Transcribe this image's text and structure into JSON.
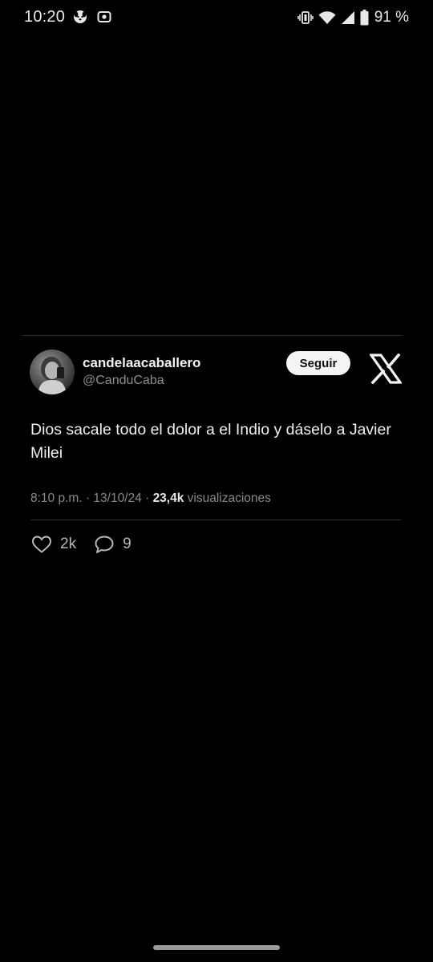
{
  "status_bar": {
    "time": "10:20",
    "battery": "91 %",
    "icons": [
      "dog-face-icon",
      "camera-icon",
      "vibrate-icon",
      "wifi-icon",
      "signal-icon",
      "battery-icon"
    ]
  },
  "tweet": {
    "display_name": "candelaacaballero",
    "handle": "@CanduCaba",
    "follow_label": "Seguir",
    "brand_icon": "x-logo-icon",
    "text": "Dios sacale todo el dolor a el Indio y dáselo a Javier Milei",
    "time": "8:10 p.m.",
    "date": "13/10/24",
    "separator": "·",
    "views": "23,4k",
    "views_label": "visualizaciones",
    "likes": "2k",
    "replies": "9"
  },
  "colors": {
    "background": "#000000",
    "text_primary": "#eeeeee",
    "text_secondary": "#8a8a8a",
    "follow_button_bg": "#f4f4f4"
  }
}
